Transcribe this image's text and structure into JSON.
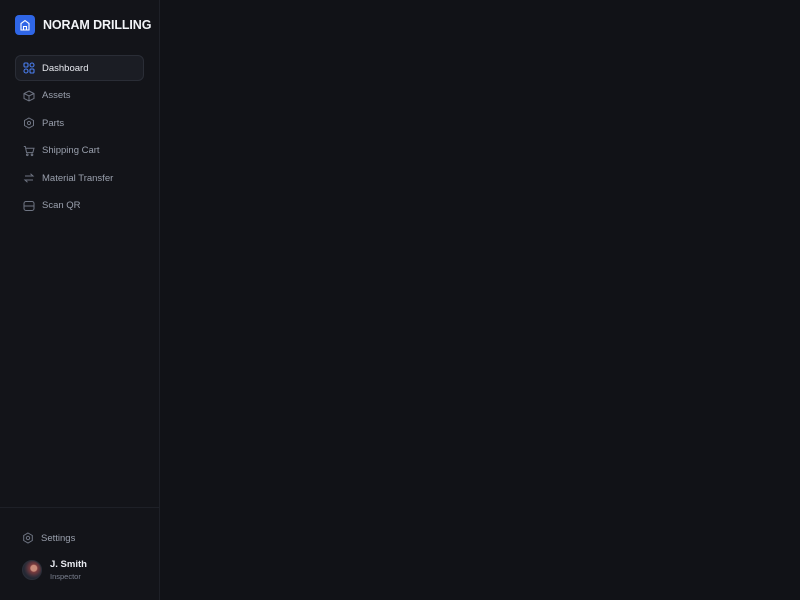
{
  "brand": {
    "name": "NORAM DRILLING",
    "logo_icon": "building-icon",
    "accent": "#2f66e6"
  },
  "sidebar": {
    "items": [
      {
        "label": "Dashboard",
        "icon": "grid-icon",
        "active": true
      },
      {
        "label": "Assets",
        "icon": "box-icon",
        "active": false
      },
      {
        "label": "Parts",
        "icon": "hexagon-gear-icon",
        "active": false
      },
      {
        "label": "Shipping Cart",
        "icon": "cart-icon",
        "active": false
      },
      {
        "label": "Material Transfer",
        "icon": "transfer-icon",
        "active": false
      },
      {
        "label": "Scan QR",
        "icon": "scan-icon",
        "active": false
      }
    ],
    "settings_label": "Settings"
  },
  "user": {
    "name": "J. Smith",
    "role": "Inspector"
  }
}
